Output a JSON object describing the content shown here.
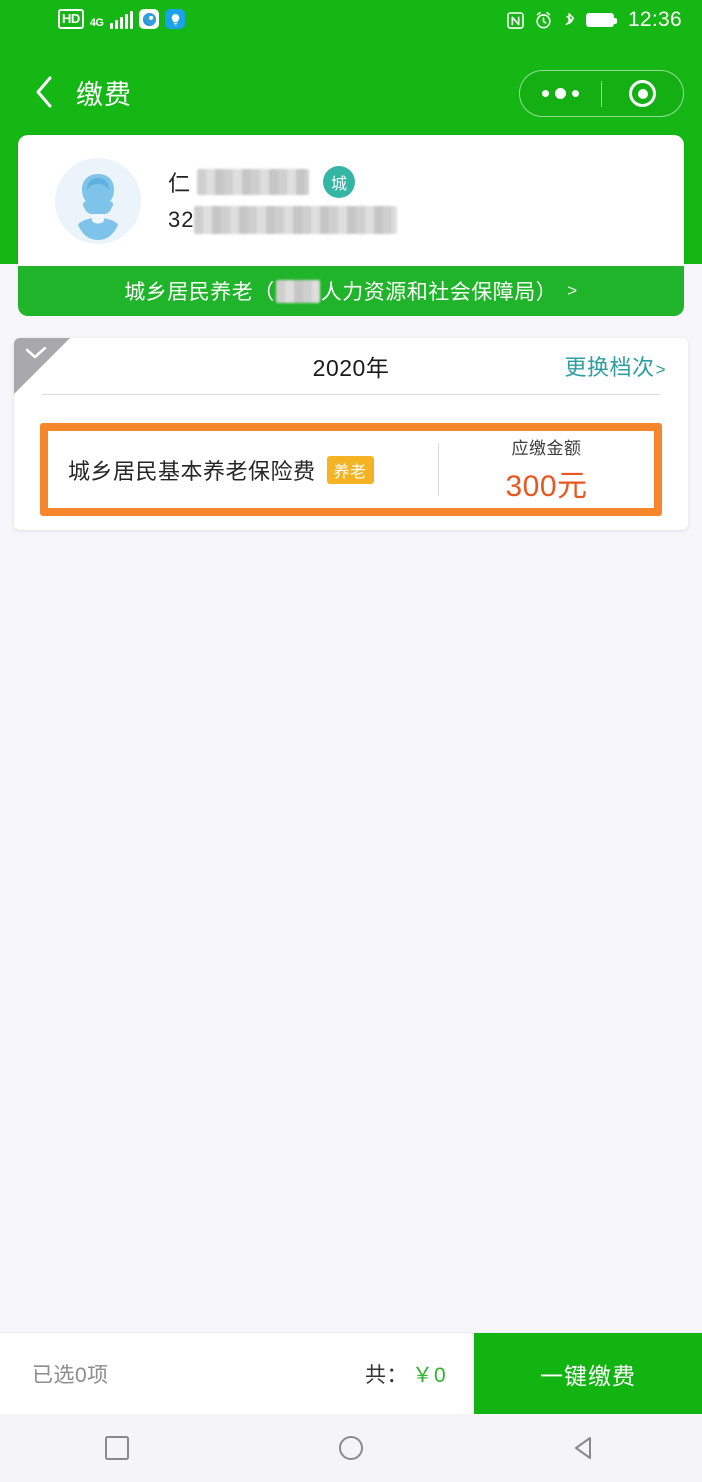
{
  "status_bar": {
    "hd_label": "HD",
    "network_label": "4G",
    "network_sub": "",
    "icons": [
      "hd-badge",
      "signal-bars-icon",
      "app-swirl-icon",
      "lightbulb-icon",
      "nfc-icon",
      "alarm-icon",
      "bluetooth-icon",
      "battery-icon"
    ],
    "time": "12:36"
  },
  "nav": {
    "back_icon": "chevron-left-icon",
    "title": "缴费",
    "capsule": {
      "more_icon": "more-dots-icon",
      "target_icon": "target-circle-icon"
    }
  },
  "user_card": {
    "avatar_icon": "user-avatar-icon",
    "name": "仁",
    "name_redacted": true,
    "badge": "城",
    "id_prefix": "32",
    "id_redacted": true
  },
  "org_bar": {
    "text_before": "城乡居民养老（",
    "redacted": true,
    "text_after": "人力资源和社会保障局）",
    "chevron": ">"
  },
  "pay_card": {
    "selected": false,
    "check_icon": "check-icon",
    "year": "2020年",
    "change_level_label": "更换档次",
    "change_level_chevron": ">",
    "item": {
      "name": "城乡居民基本养老保险费",
      "tag": "养老",
      "amount_label": "应缴金额",
      "amount_value": "300元"
    }
  },
  "bottom_bar": {
    "selected_count": "已选0项",
    "total_label": "共：",
    "total_value": "￥0",
    "pay_button": "一键缴费"
  },
  "android_nav": {
    "recents_icon": "square-recents-icon",
    "home_icon": "circle-home-icon",
    "back_icon": "triangle-back-icon"
  },
  "colors": {
    "header_green": "#14b714",
    "org_green": "#20b42a",
    "button_green": "#11b411",
    "amount_orange": "#e8571f",
    "item_border_orange": "#f5862c",
    "tag_amber": "#f5b324",
    "link_teal": "#2f9e9e",
    "page_bg": "#f7f7fb"
  }
}
